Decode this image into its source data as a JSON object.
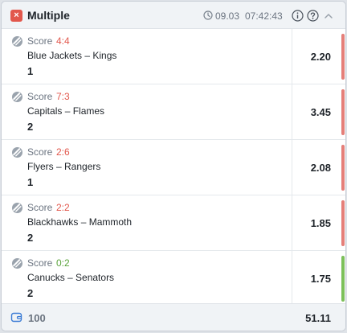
{
  "header": {
    "close_glyph": "×",
    "title": "Multiple",
    "date": "09.03",
    "time": "07:42:43",
    "icons": [
      "clock-icon",
      "info-icon",
      "help-icon",
      "chevron-up-icon"
    ]
  },
  "colors": {
    "lost": "#e2574c",
    "lost_bar": "#e57f79",
    "won": "#5aa33b",
    "won_bar": "#7cc05a"
  },
  "bets": [
    {
      "score_label": "Score",
      "score": "4:4",
      "teams": "Blue Jackets – Kings",
      "pick": "1",
      "odds": "2.20",
      "status": "lost"
    },
    {
      "score_label": "Score",
      "score": "7:3",
      "teams": "Capitals – Flames",
      "pick": "2",
      "odds": "3.45",
      "status": "lost"
    },
    {
      "score_label": "Score",
      "score": "2:6",
      "teams": "Flyers – Rangers",
      "pick": "1",
      "odds": "2.08",
      "status": "lost"
    },
    {
      "score_label": "Score",
      "score": "2:2",
      "teams": "Blackhawks – Mammoth",
      "pick": "2",
      "odds": "1.85",
      "status": "lost"
    },
    {
      "score_label": "Score",
      "score": "0:2",
      "teams": "Canucks – Senators",
      "pick": "2",
      "odds": "1.75",
      "status": "won"
    }
  ],
  "footer": {
    "stake": "100",
    "total_odds": "51.11",
    "icon": "wallet-icon"
  }
}
